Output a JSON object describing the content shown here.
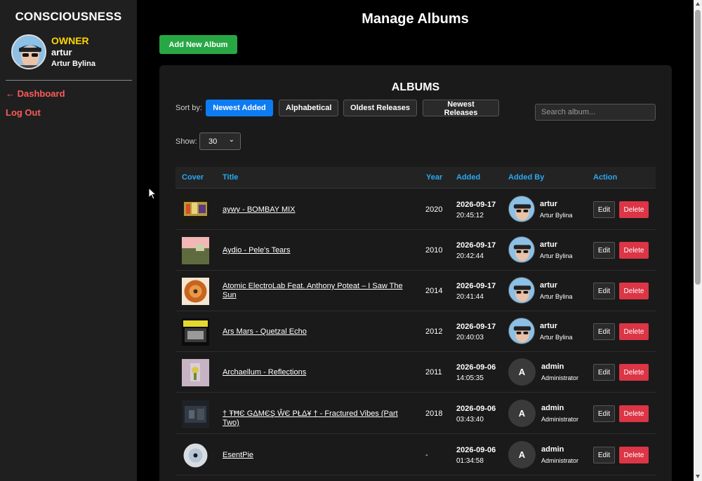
{
  "sidebar": {
    "brand": "CONSCIOUSNESS",
    "role": "OWNER",
    "username": "artur",
    "fullname": "Artur Bylina",
    "links": {
      "dashboard": "← Dashboard",
      "logout": "Log Out"
    }
  },
  "main": {
    "title": "Manage Albums",
    "add_button": "Add New Album"
  },
  "albums_panel": {
    "title": "ALBUMS",
    "sort_label": "Sort by:",
    "sort_options": [
      "Newest Added",
      "Alphabetical",
      "Oldest Releases",
      "Newest Releases"
    ],
    "sort_active": "Newest Added",
    "search_placeholder": "Search album...",
    "show_label": "Show:",
    "show_value": "30",
    "columns": [
      "Cover",
      "Title",
      "Year",
      "Added",
      "Added By",
      "Action"
    ],
    "rows": [
      {
        "title": "aywy - BOMBAY MIX",
        "year": "2020",
        "date": "2026-09-17",
        "time": "20:45:12",
        "user": "artur",
        "user_full": "Artur Bylina",
        "avatar": "photo"
      },
      {
        "title": "Aydio - Pele's Tears",
        "year": "2010",
        "date": "2026-09-17",
        "time": "20:42:44",
        "user": "artur",
        "user_full": "Artur Bylina",
        "avatar": "photo"
      },
      {
        "title": "Atomic ElectroLab Feat. Anthony Poteat – I Saw The Sun",
        "year": "2014",
        "date": "2026-09-17",
        "time": "20:41:44",
        "user": "artur",
        "user_full": "Artur Bylina",
        "avatar": "photo"
      },
      {
        "title": "Ars Mars - Quetzal Echo",
        "year": "2012",
        "date": "2026-09-17",
        "time": "20:40:03",
        "user": "artur",
        "user_full": "Artur Bylina",
        "avatar": "photo"
      },
      {
        "title": "Archaellum - Reflections",
        "year": "2011",
        "date": "2026-09-06",
        "time": "14:05:35",
        "user": "admin",
        "user_full": "Administrator",
        "avatar": "A"
      },
      {
        "title": "† ŦĦЄ GΔMЄŞ ŴЄ PŁΔ¥ † - Fractured Vibes (Part Two)",
        "year": "2018",
        "date": "2026-09-06",
        "time": "03:43:40",
        "user": "admin",
        "user_full": "Administrator",
        "avatar": "A"
      },
      {
        "title": "EsentPie",
        "year": "-",
        "date": "2026-09-06",
        "time": "01:34:58",
        "user": "admin",
        "user_full": "Administrator",
        "avatar": "A"
      }
    ],
    "edit_label": "Edit",
    "delete_label": "Delete"
  },
  "colors": {
    "accent_header": "#2aa8f2",
    "add_button": "#28a745",
    "sort_active": "#0d7bf2",
    "delete": "#dc3545",
    "role": "#ffd500",
    "side_links": "#ff5b5b"
  }
}
